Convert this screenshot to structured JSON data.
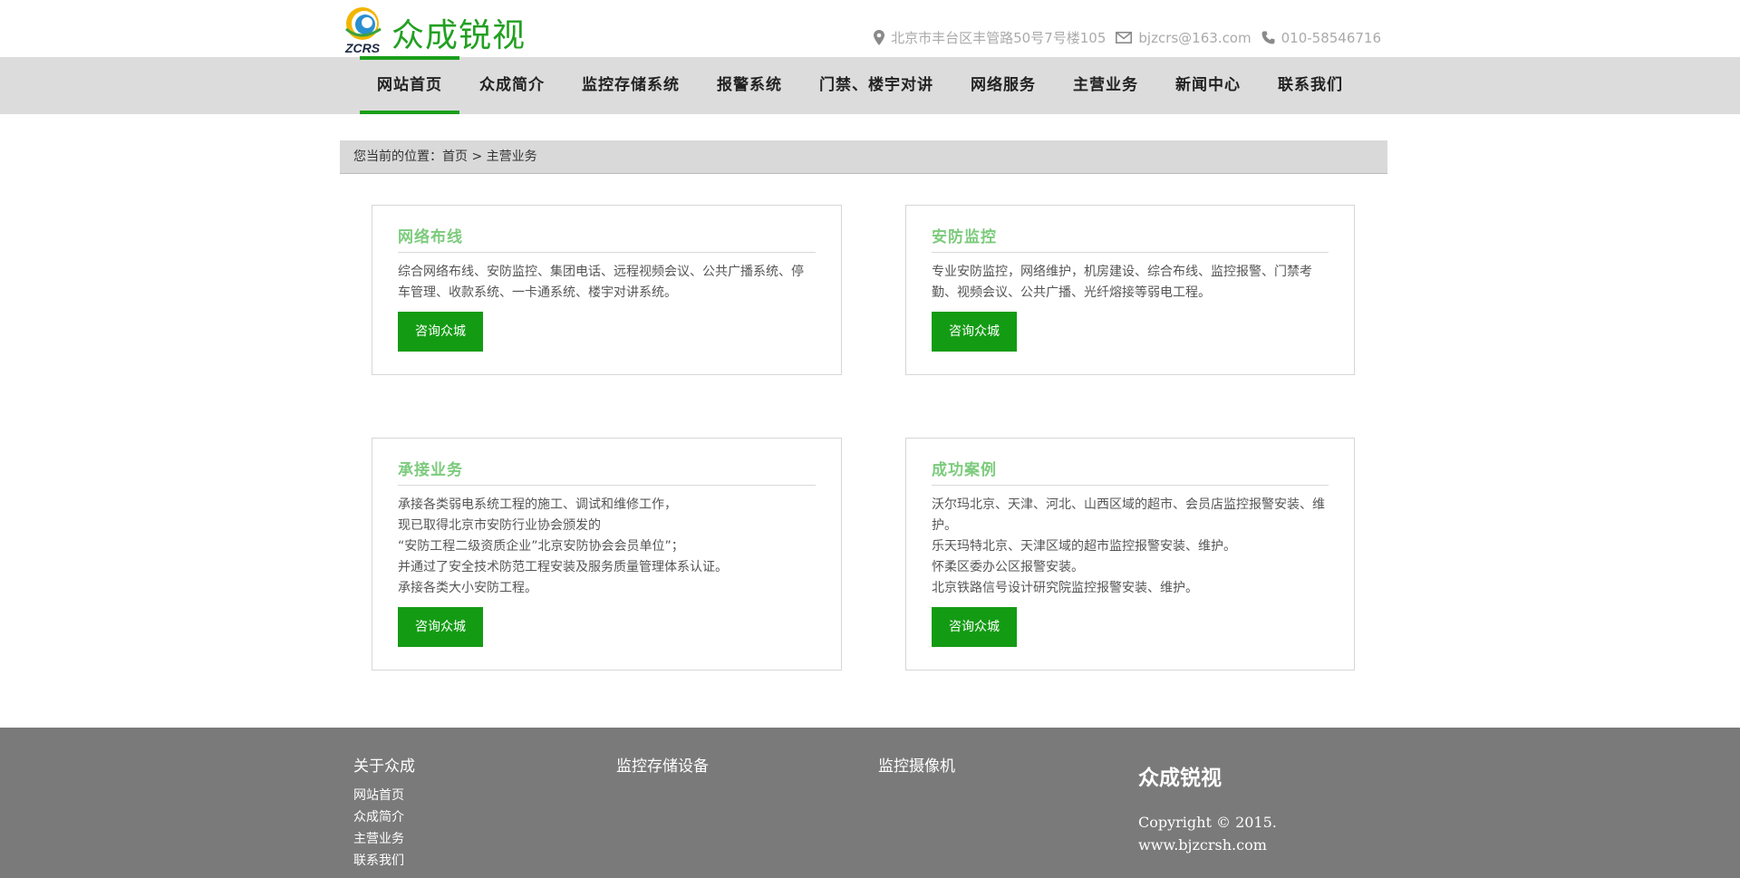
{
  "header": {
    "logo_text": "众成锐视",
    "logo_abbr": "ZCRS",
    "contact": {
      "address": "北京市丰台区丰管路50号7号楼105",
      "email": "bjzcrs@163.com",
      "phone": "010-58546716"
    }
  },
  "nav": {
    "items": [
      {
        "label": "网站首页",
        "active": true
      },
      {
        "label": "众成简介"
      },
      {
        "label": "监控存储系统"
      },
      {
        "label": "报警系统"
      },
      {
        "label": "门禁、楼宇对讲"
      },
      {
        "label": "网络服务"
      },
      {
        "label": "主营业务"
      },
      {
        "label": "新闻中心"
      },
      {
        "label": "联系我们"
      }
    ],
    "accent_color": "#1a9f1a"
  },
  "breadcrumb": {
    "prefix": "您当前的位置：",
    "home": "首页",
    "separator": " > ",
    "current": "主营业务"
  },
  "cards": [
    {
      "title": "网络布线",
      "lines": [
        "综合网络布线、安防监控、集团电话、远程视频会议、公共广播系统、停车管理、收款系统、一卡通系统、楼宇对讲系统。"
      ],
      "button": "咨询众城"
    },
    {
      "title": "安防监控",
      "lines": [
        "专业安防监控，网络维护，机房建设、综合布线、监控报警、门禁考勤、视频会议、公共广播、光纤熔接等弱电工程。"
      ],
      "button": "咨询众城"
    },
    {
      "title": "承接业务",
      "lines": [
        "承接各类弱电系统工程的施工、调试和维修工作，",
        "现已取得北京市安防行业协会颁发的",
        "“安防工程二级资质企业”北京安防协会会员单位”；",
        "并通过了安全技术防范工程安装及服务质量管理体系认证。",
        "承接各类大小安防工程。"
      ],
      "button": "咨询众城"
    },
    {
      "title": "成功案例",
      "lines": [
        "沃尔玛北京、天津、河北、山西区域的超市、会员店监控报警安装、维护。",
        "乐天玛特北京、天津区域的超市监控报警安装、维护。",
        "怀柔区委办公区报警安装。",
        "北京铁路信号设计研究院监控报警安装、维护。"
      ],
      "button": "咨询众城"
    }
  ],
  "footer": {
    "col1": {
      "title": "关于众成",
      "links": [
        "网站首页",
        "众成简介",
        "主营业务",
        "联系我们"
      ]
    },
    "col2": {
      "title": "监控存储设备"
    },
    "col3": {
      "title": "监控摄像机"
    },
    "brand": {
      "name": "众成锐视",
      "copyright": "Copyright © 2015.",
      "site": "www.bjzcrsh.com"
    }
  }
}
